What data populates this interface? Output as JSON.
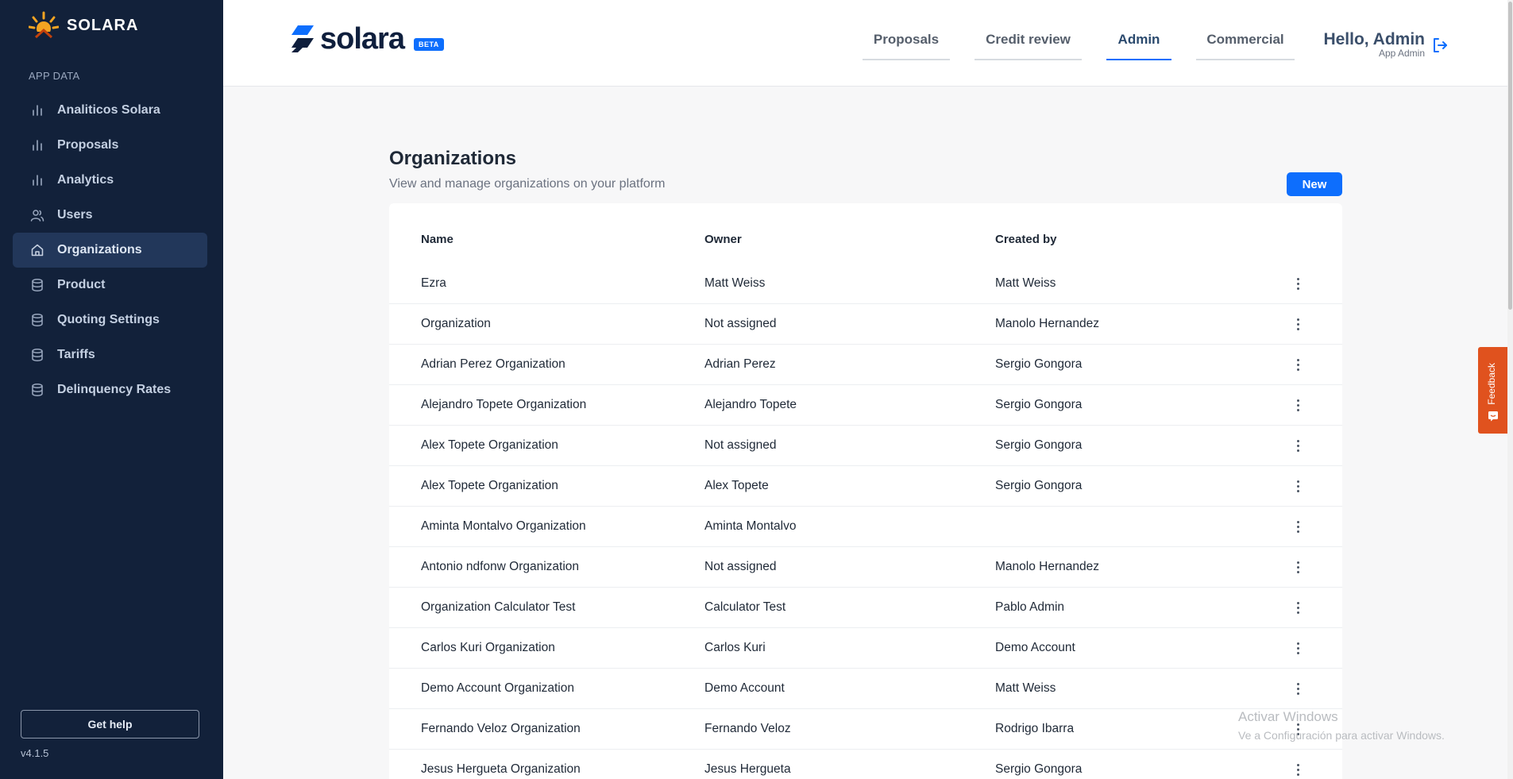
{
  "sidebar": {
    "logo_text": "SOLARA",
    "section_label": "APP DATA",
    "items": [
      {
        "label": "Analiticos Solara",
        "icon": "bar-chart-icon",
        "active": false
      },
      {
        "label": "Proposals",
        "icon": "bar-chart-icon",
        "active": false
      },
      {
        "label": "Analytics",
        "icon": "bar-chart-icon",
        "active": false
      },
      {
        "label": "Users",
        "icon": "users-icon",
        "active": false
      },
      {
        "label": "Organizations",
        "icon": "home-icon",
        "active": true
      },
      {
        "label": "Product",
        "icon": "database-icon",
        "active": false
      },
      {
        "label": "Quoting Settings",
        "icon": "database-icon",
        "active": false
      },
      {
        "label": "Tariffs",
        "icon": "database-icon",
        "active": false
      },
      {
        "label": "Delinquency Rates",
        "icon": "database-icon",
        "active": false
      }
    ],
    "help_label": "Get help",
    "version": "v4.1.5"
  },
  "header": {
    "brand": "solara",
    "beta": "BETA",
    "nav": [
      {
        "label": "Proposals",
        "active": false
      },
      {
        "label": "Credit review",
        "active": false
      },
      {
        "label": "Admin",
        "active": true
      },
      {
        "label": "Commercial",
        "active": false
      }
    ],
    "greeting": "Hello, Admin",
    "role": "App Admin"
  },
  "page": {
    "title": "Organizations",
    "subtitle": "View and manage organizations on your platform",
    "new_label": "New"
  },
  "table": {
    "columns": [
      "Name",
      "Owner",
      "Created by"
    ],
    "rows": [
      {
        "name": "Ezra",
        "owner": "Matt Weiss",
        "created_by": "Matt Weiss"
      },
      {
        "name": "Organization",
        "owner": "Not assigned",
        "created_by": "Manolo Hernandez"
      },
      {
        "name": "Adrian Perez Organization",
        "owner": "Adrian Perez",
        "created_by": "Sergio Gongora"
      },
      {
        "name": "Alejandro Topete Organization",
        "owner": "Alejandro Topete",
        "created_by": "Sergio Gongora"
      },
      {
        "name": "Alex Topete Organization",
        "owner": "Not assigned",
        "created_by": "Sergio Gongora"
      },
      {
        "name": "Alex Topete Organization",
        "owner": "Alex Topete",
        "created_by": "Sergio Gongora"
      },
      {
        "name": "Aminta Montalvo Organization",
        "owner": "Aminta Montalvo",
        "created_by": ""
      },
      {
        "name": "Antonio ndfonw Organization",
        "owner": "Not assigned",
        "created_by": "Manolo Hernandez"
      },
      {
        "name": "Organization Calculator Test",
        "owner": "Calculator Test",
        "created_by": "Pablo Admin"
      },
      {
        "name": "Carlos Kuri Organization",
        "owner": "Carlos Kuri",
        "created_by": "Demo Account"
      },
      {
        "name": "Demo Account Organization",
        "owner": "Demo Account",
        "created_by": "Matt Weiss"
      },
      {
        "name": "Fernando Veloz Organization",
        "owner": "Fernando Veloz",
        "created_by": "Rodrigo Ibarra"
      },
      {
        "name": "Jesus Hergueta Organization",
        "owner": "Jesus Hergueta",
        "created_by": "Sergio Gongora"
      }
    ]
  },
  "feedback_label": "Feedback",
  "watermark": {
    "line1": "Activar Windows",
    "line2": "Ve a Configuración para activar Windows."
  },
  "colors": {
    "sidebar_bg": "#12213a",
    "accent": "#0d6efd",
    "feedback": "#e0521e"
  }
}
